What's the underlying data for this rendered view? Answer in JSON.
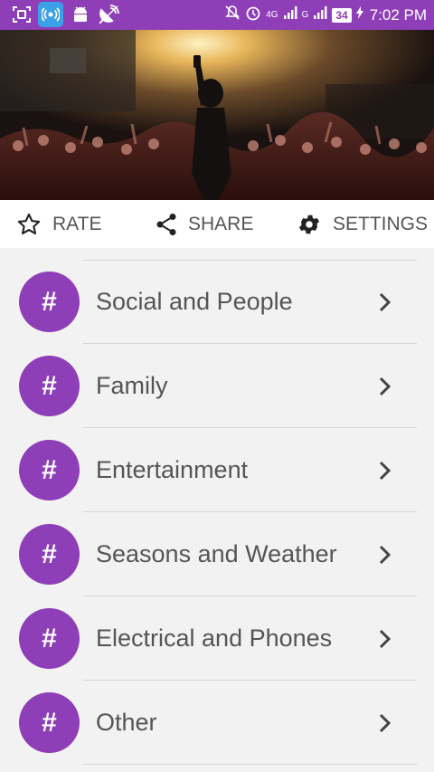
{
  "status_bar": {
    "network_label": "4G",
    "network_label_2": "G",
    "battery": "34",
    "time": "7:02 PM",
    "icons": [
      "screenshot-icon",
      "hotspot-app-icon",
      "android-icon",
      "satellite-dish-icon",
      "mute-bell-icon",
      "alarm-icon",
      "signal-icon",
      "battery-icon",
      "charging-icon"
    ]
  },
  "hero": {
    "image": "concert-crowd-with-singer-photo"
  },
  "actions": {
    "rate": "RATE",
    "share": "SHARE",
    "settings": "SETTINGS"
  },
  "categories": [
    {
      "label": "Social and People",
      "badge": "#"
    },
    {
      "label": "Family",
      "badge": "#"
    },
    {
      "label": "Entertainment",
      "badge": "#"
    },
    {
      "label": "Seasons and Weather",
      "badge": "#"
    },
    {
      "label": "Electrical and Phones",
      "badge": "#"
    },
    {
      "label": "Other",
      "badge": "#"
    }
  ],
  "colors": {
    "accent": "#8e3fb8",
    "text": "#555555",
    "background": "#f2f2f2"
  }
}
